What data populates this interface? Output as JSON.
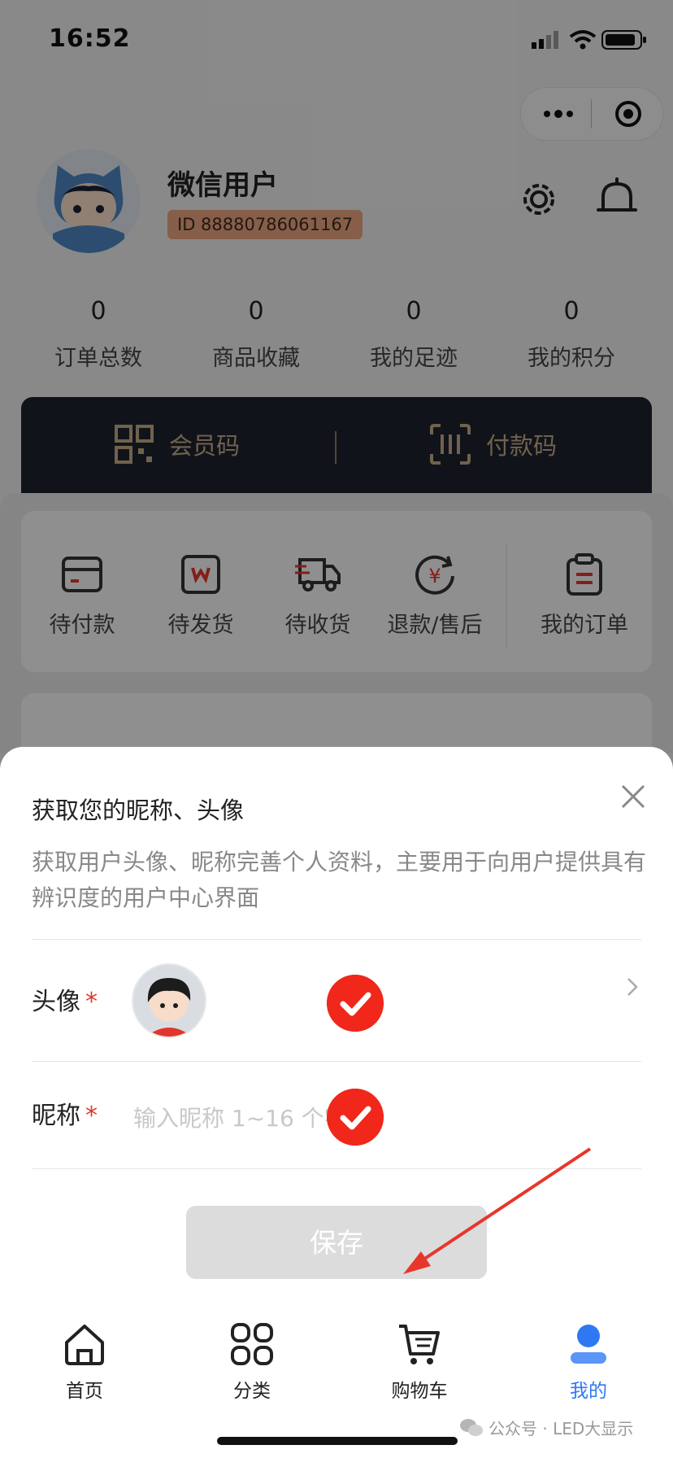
{
  "status_bar": {
    "time": "16:52"
  },
  "profile": {
    "name": "微信用户",
    "id": "ID 88880786061167"
  },
  "stats": [
    {
      "value": "0",
      "label": "订单总数"
    },
    {
      "value": "0",
      "label": "商品收藏"
    },
    {
      "value": "0",
      "label": "我的足迹"
    },
    {
      "value": "0",
      "label": "我的积分"
    }
  ],
  "vip": {
    "member_code": "会员码",
    "pay_code": "付款码"
  },
  "orders": {
    "pending_payment": "待付款",
    "pending_shipment": "待发货",
    "pending_receipt": "待收货",
    "refund": "退款/售后",
    "my_orders": "我的订单"
  },
  "dialog": {
    "title": "获取您的昵称、头像",
    "description": "获取用户头像、昵称完善个人资料，主要用于向用户提供具有辨识度的用户中心界面",
    "avatar_label": "头像",
    "nickname_label": "昵称",
    "required_mark": "*",
    "nickname_placeholder": "输入昵称 1~16 个字",
    "nickname_value": "",
    "save_label": "保存"
  },
  "tabs": [
    {
      "label": "首页",
      "icon": "home-icon"
    },
    {
      "label": "分类",
      "icon": "grid-icon"
    },
    {
      "label": "购物车",
      "icon": "cart-icon"
    },
    {
      "label": "我的",
      "icon": "user-icon"
    }
  ],
  "watermark": "公众号 · LED大显示",
  "colors": {
    "accent": "#2f78f4",
    "check": "#f0271a",
    "required": "#e0362b",
    "vip_gold": "#c1a984",
    "arrow": "#e8362b"
  }
}
